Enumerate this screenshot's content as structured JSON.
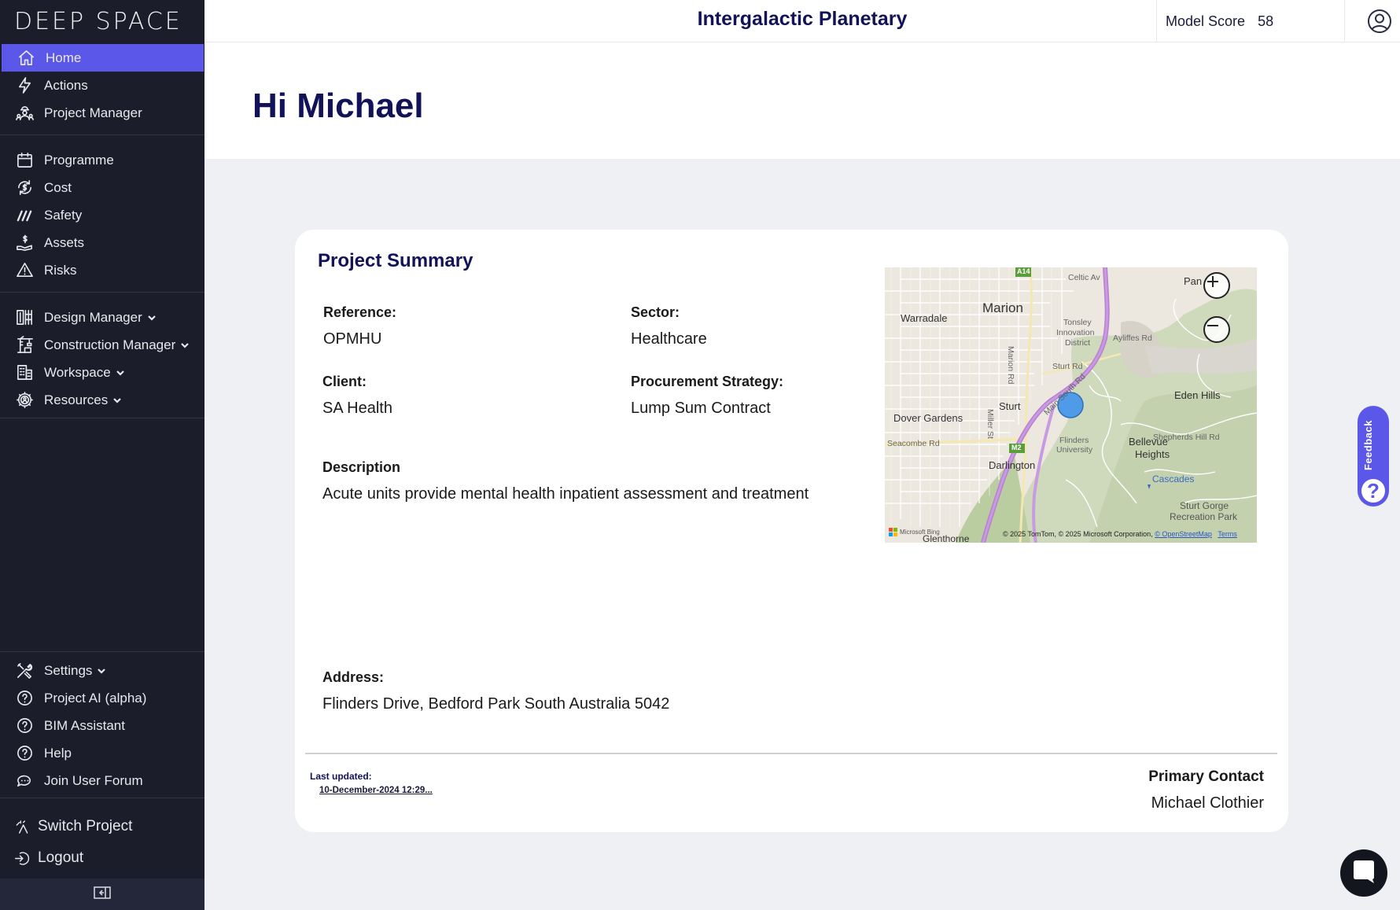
{
  "sidebar": {
    "logo": "DEEP SPACE",
    "primary": [
      {
        "label": "Home",
        "icon": "home-icon",
        "active": true
      },
      {
        "label": "Actions",
        "icon": "lightning-icon"
      },
      {
        "label": "Project Manager",
        "icon": "people-icon"
      }
    ],
    "modules": [
      {
        "label": "Programme",
        "icon": "calendar-icon"
      },
      {
        "label": "Cost",
        "icon": "dollar-cycle-icon"
      },
      {
        "label": "Safety",
        "icon": "stripes-icon"
      },
      {
        "label": "Assets",
        "icon": "hand-money-icon"
      },
      {
        "label": "Risks",
        "icon": "warning-icon"
      }
    ],
    "managers": [
      {
        "label": "Design Manager",
        "icon": "blueprint-icon"
      },
      {
        "label": "Construction Manager",
        "icon": "crane-icon"
      },
      {
        "label": "Workspace",
        "icon": "building-icon"
      },
      {
        "label": "Resources",
        "icon": "gear-people-icon"
      }
    ],
    "bottom": [
      {
        "label": "Settings",
        "icon": "tools-icon"
      },
      {
        "label": "Project AI (alpha)",
        "icon": "question-circle-icon"
      },
      {
        "label": "BIM Assistant",
        "icon": "question-circle-icon"
      },
      {
        "label": "Help",
        "icon": "question-circle-icon"
      },
      {
        "label": "Join User Forum",
        "icon": "chat-bubbles-icon"
      }
    ],
    "switch_project": "Switch Project",
    "logout": "Logout"
  },
  "topbar": {
    "title": "Intergalactic Planetary",
    "model_score_label": "Model Score",
    "model_score_value": "58"
  },
  "greeting": "Hi Michael",
  "summary": {
    "title": "Project Summary",
    "reference_label": "Reference:",
    "reference_value": "OPMHU",
    "sector_label": "Sector:",
    "sector_value": "Healthcare",
    "client_label": "Client:",
    "client_value": "SA Health",
    "procurement_label": "Procurement Strategy:",
    "procurement_value": "Lump Sum Contract",
    "description_label": "Description",
    "description_value": "Acute units provide mental health inpatient assessment and treatment",
    "address_label": "Address:",
    "address_value": "Flinders Drive, Bedford Park South Australia 5042",
    "last_updated_label": "Last updated:",
    "last_updated_value": "10-December-2024 12:29...",
    "primary_contact_label": "Primary Contact",
    "primary_contact_value": "Michael Clothier"
  },
  "map": {
    "labels": {
      "warradale": "Warradale",
      "marion": "Marion",
      "tonsley": "Tonsley",
      "innovation": "Innovation",
      "district": "District",
      "pan": "Pan",
      "eden_hills": "Eden Hills",
      "dover_gardens": "Dover Gardens",
      "sturt": "Sturt",
      "bellevue": "Bellevue",
      "heights": "Heights",
      "flinders": "Flinders",
      "university": "University",
      "darlington": "Darlington",
      "cascades": "Cascades",
      "sturt_gorge": "Sturt Gorge",
      "recreation_park": "Recreation Park",
      "glenthorne": "Glenthorne",
      "seacombe_rd": "Seacombe Rd",
      "sturt_rd": "Sturt Rd",
      "celtic_av": "Celtic Av",
      "ayliffes_rd": "Ayliffes Rd",
      "shepherds_hill_rd": "Shepherds Hill Rd",
      "marion_rd": "Marion Rd",
      "main_south_rd": "Main South Rd",
      "miller_st": "Miller St",
      "a14": "A14",
      "m2": "M2"
    },
    "bing_label": "Microsoft Bing",
    "attribution": "© 2025 TomTom, © 2025 Microsoft Corporation,",
    "osm_link": "© OpenStreetMap",
    "terms_link": "Terms"
  },
  "feedback": {
    "label": "Feedback",
    "help_glyph": "?"
  }
}
